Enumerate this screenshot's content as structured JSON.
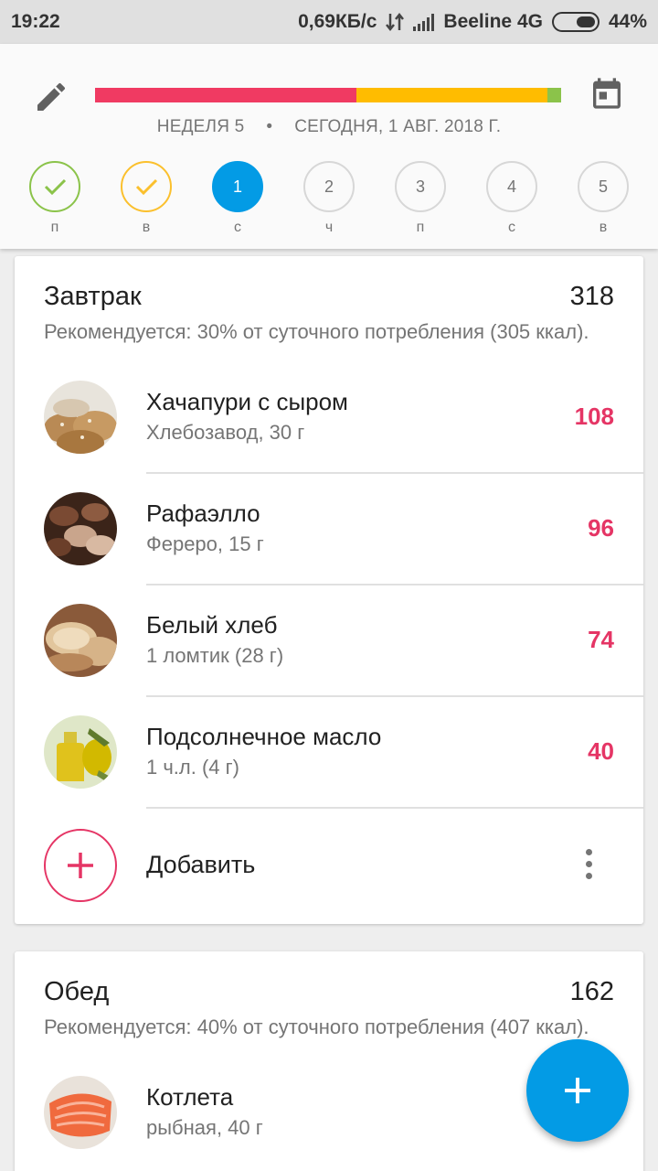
{
  "status_bar": {
    "time": "19:22",
    "speed": "0,69КБ/с",
    "carrier": "Beeline 4G",
    "battery": "44%"
  },
  "header": {
    "week_label": "НЕДЕЛЯ 5",
    "separator": "•",
    "date_label": "СЕГОДНЯ, 1 АВГ. 2018 Г.",
    "progress_segments": [
      {
        "color": "#f03a62",
        "fraction": 0.56
      },
      {
        "color": "#ffbc00",
        "fraction": 0.41
      },
      {
        "color": "#8bc34a",
        "fraction": 0.03
      }
    ],
    "days": [
      {
        "label": "п",
        "number": "",
        "state": "done-green"
      },
      {
        "label": "в",
        "number": "",
        "state": "done-yellow"
      },
      {
        "label": "с",
        "number": "1",
        "state": "active"
      },
      {
        "label": "ч",
        "number": "2",
        "state": "future"
      },
      {
        "label": "п",
        "number": "3",
        "state": "future"
      },
      {
        "label": "с",
        "number": "4",
        "state": "future"
      },
      {
        "label": "в",
        "number": "5",
        "state": "future"
      }
    ]
  },
  "breakfast": {
    "title": "Завтрак",
    "total": "318",
    "recommendation": "Рекомендуется: 30% от суточного потребления (305 ккал).",
    "items": [
      {
        "name": "Хачапури с сыром",
        "sub": "Хлебозавод, 30 г",
        "kcal": "108",
        "image": "bread-rolls"
      },
      {
        "name": "Рафаэлло",
        "sub": "Фереро, 15 г",
        "kcal": "96",
        "image": "chocolates"
      },
      {
        "name": "Белый хлеб",
        "sub": "1 ломтик (28 г)",
        "kcal": "74",
        "image": "white-bread"
      },
      {
        "name": "Подсолнечное масло",
        "sub": "1 ч.л. (4 г)",
        "kcal": "40",
        "image": "oil-bottle"
      }
    ],
    "add_label": "Добавить"
  },
  "lunch": {
    "title": "Обед",
    "total": "162",
    "recommendation": "Рекомендуется: 40% от суточного потребления (407 ккал).",
    "items": [
      {
        "name": "Котлета",
        "sub": "рыбная, 40 г",
        "kcal": "",
        "image": "salmon"
      }
    ]
  },
  "colors": {
    "accent_blue": "#039be5",
    "accent_red": "#e53565",
    "check_green": "#8bc34a",
    "check_yellow": "#fbc02d"
  }
}
